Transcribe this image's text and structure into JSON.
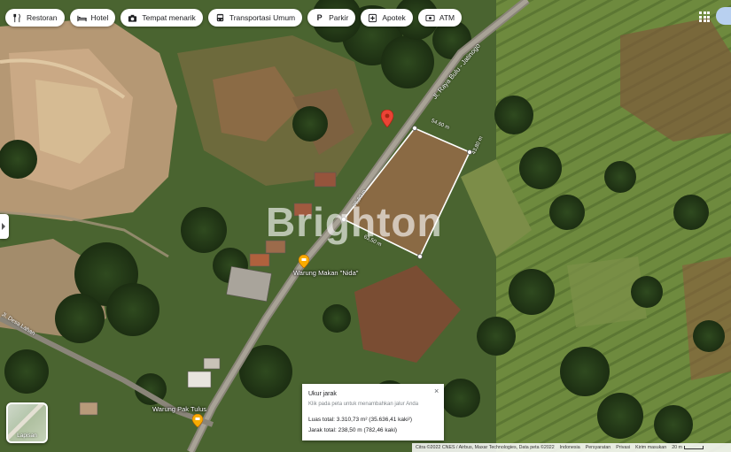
{
  "chips": [
    {
      "label": "Restoran",
      "icon": "fork-knife-icon",
      "glyph": "🍴"
    },
    {
      "label": "Hotel",
      "icon": "bed-icon",
      "glyph": "🛏"
    },
    {
      "label": "Tempat menarik",
      "icon": "camera-icon",
      "glyph": "⌖"
    },
    {
      "label": "Transportasi Umum",
      "icon": "bus-icon",
      "glyph": "⌸"
    },
    {
      "label": "Parkir",
      "icon": "parking-icon",
      "glyph": "P"
    },
    {
      "label": "Apotek",
      "icon": "pharmacy-icon",
      "glyph": "✚"
    },
    {
      "label": "ATM",
      "icon": "atm-icon",
      "glyph": "▣"
    }
  ],
  "map": {
    "watermark": "Brighton",
    "roads": {
      "main": "Jl. Raya Bulu - Jatinogo",
      "side": "Jl. Desa Lahan"
    },
    "places": [
      {
        "name": "Warung Makan \"Nida\"",
        "icon": "shop-pin-icon"
      },
      {
        "name": "Warung Pak Tulus",
        "icon": "shop-pin-icon"
      }
    ],
    "edge_labels": [
      "54,60 m",
      "43,80 m",
      "63,50 m",
      "76,80 m"
    ],
    "layer_button": "Lapisan",
    "colors": {
      "pin": "#ea4335",
      "poi": "#f9ab00",
      "measure_line": "#ffffff"
    }
  },
  "measure": {
    "title": "Ukur jarak",
    "subtitle": "Klik pada peta untuk menambahkan jalur Anda",
    "area": "Luas total: 3.310,73 m² (35.636,41 kaki²)",
    "distance": "Jarak total: 238,50 m (782,46 kaki)",
    "close": "×"
  },
  "footer": {
    "attribution": "Citra ©2022 CNES / Airbus, Maxar Technologies, Data peta ©2022",
    "country": "Indonesia",
    "terms": "Persyaratan",
    "privacy": "Privasi",
    "feedback": "Kirim masukan",
    "scale": "20 m"
  }
}
